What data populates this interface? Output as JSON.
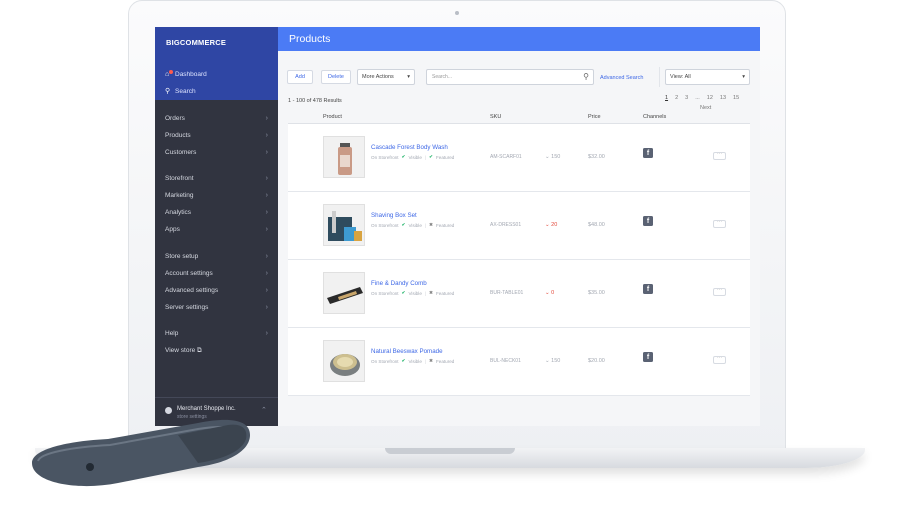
{
  "app": {
    "logo_text": "BIGCOMMERCE",
    "page_title": "Products"
  },
  "sidebar": {
    "top_links": [
      {
        "label": "Dashboard",
        "icon": "home-icon"
      },
      {
        "label": "Search",
        "icon": "search-icon"
      }
    ],
    "items": [
      {
        "label": "Orders",
        "chevron": "›"
      },
      {
        "label": "Products",
        "chevron": "›"
      },
      {
        "label": "Customers",
        "chevron": "›"
      },
      {
        "label": "Storefront",
        "chevron": "›"
      },
      {
        "label": "Marketing",
        "chevron": "›"
      },
      {
        "label": "Analytics",
        "chevron": "›"
      },
      {
        "label": "Apps",
        "chevron": "›"
      },
      {
        "label": "Store setup",
        "chevron": "›"
      },
      {
        "label": "Account settings",
        "chevron": "›"
      },
      {
        "label": "Advanced settings",
        "chevron": "›"
      },
      {
        "label": "Server settings",
        "chevron": "›"
      },
      {
        "label": "Help",
        "chevron": "›"
      },
      {
        "label": "View store ⧉",
        "chevron": ""
      }
    ],
    "footer": {
      "store_name": "Merchant Shoppe Inc.",
      "store_sub": "store settings"
    }
  },
  "toolbar": {
    "add_label": "Add",
    "delete_label": "Delete",
    "more_actions_label": "More Actions",
    "search_placeholder": "Search...",
    "advanced_search_label": "Advanced Search",
    "view_label": "View: All"
  },
  "results": {
    "summary": "1 - 100 of 478 Results",
    "pages": [
      "1",
      "2",
      "3",
      "...",
      "12",
      "13",
      "15"
    ],
    "next_label": "Next"
  },
  "table": {
    "columns": {
      "product": "Product",
      "sku": "SKU",
      "price": "Price",
      "channels": "Channels"
    },
    "rows": [
      {
        "name": "Cascade Forest Body Wash",
        "on_storefront": "On Storefront",
        "visible": "Visible",
        "featured": "Featured",
        "featured_icon": "✔",
        "sku": "AM-SCARF01",
        "stock": "150",
        "stock_alert": false,
        "price": "$32.00",
        "channel": "facebook"
      },
      {
        "name": "Shaving Box Set",
        "on_storefront": "On Storefront",
        "visible": "Visible",
        "featured": "Featured",
        "featured_icon": "✖",
        "sku": "AX-DRESS01",
        "stock": "20",
        "stock_alert": true,
        "price": "$48.00",
        "channel": "facebook"
      },
      {
        "name": "Fine & Dandy Comb",
        "on_storefront": "On Storefront",
        "visible": "Visible",
        "featured": "Featured",
        "featured_icon": "✖",
        "sku": "BUR-TABLE01",
        "stock": "0",
        "stock_alert": true,
        "price": "$35.00",
        "channel": "facebook"
      },
      {
        "name": "Natural Beeswax Pomade",
        "on_storefront": "On Storefront",
        "visible": "Visible",
        "featured": "Featured",
        "featured_icon": "✖",
        "sku": "BUL-NECK01",
        "stock": "150",
        "stock_alert": false,
        "price": "$20.00",
        "channel": "facebook"
      }
    ]
  },
  "colors": {
    "brand_blue": "#4b7bf5",
    "sidebar_dark": "#313440",
    "sidebar_top": "#2f46a4",
    "link_blue": "#3e68e6",
    "ok_green": "#2eb872",
    "alert_red": "#e2483a"
  }
}
